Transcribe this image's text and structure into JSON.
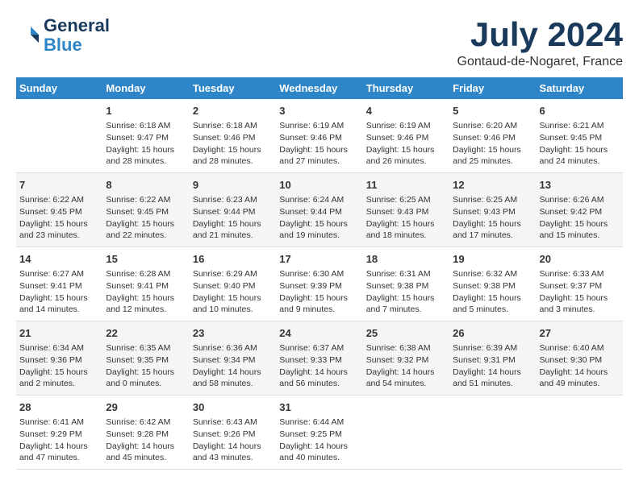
{
  "logo": {
    "general": "General",
    "blue": "Blue"
  },
  "title": "July 2024",
  "subtitle": "Gontaud-de-Nogaret, France",
  "days_header": [
    "Sunday",
    "Monday",
    "Tuesday",
    "Wednesday",
    "Thursday",
    "Friday",
    "Saturday"
  ],
  "weeks": [
    [
      {
        "num": "",
        "info": ""
      },
      {
        "num": "1",
        "info": "Sunrise: 6:18 AM\nSunset: 9:47 PM\nDaylight: 15 hours\nand 28 minutes."
      },
      {
        "num": "2",
        "info": "Sunrise: 6:18 AM\nSunset: 9:46 PM\nDaylight: 15 hours\nand 28 minutes."
      },
      {
        "num": "3",
        "info": "Sunrise: 6:19 AM\nSunset: 9:46 PM\nDaylight: 15 hours\nand 27 minutes."
      },
      {
        "num": "4",
        "info": "Sunrise: 6:19 AM\nSunset: 9:46 PM\nDaylight: 15 hours\nand 26 minutes."
      },
      {
        "num": "5",
        "info": "Sunrise: 6:20 AM\nSunset: 9:46 PM\nDaylight: 15 hours\nand 25 minutes."
      },
      {
        "num": "6",
        "info": "Sunrise: 6:21 AM\nSunset: 9:45 PM\nDaylight: 15 hours\nand 24 minutes."
      }
    ],
    [
      {
        "num": "7",
        "info": "Sunrise: 6:22 AM\nSunset: 9:45 PM\nDaylight: 15 hours\nand 23 minutes."
      },
      {
        "num": "8",
        "info": "Sunrise: 6:22 AM\nSunset: 9:45 PM\nDaylight: 15 hours\nand 22 minutes."
      },
      {
        "num": "9",
        "info": "Sunrise: 6:23 AM\nSunset: 9:44 PM\nDaylight: 15 hours\nand 21 minutes."
      },
      {
        "num": "10",
        "info": "Sunrise: 6:24 AM\nSunset: 9:44 PM\nDaylight: 15 hours\nand 19 minutes."
      },
      {
        "num": "11",
        "info": "Sunrise: 6:25 AM\nSunset: 9:43 PM\nDaylight: 15 hours\nand 18 minutes."
      },
      {
        "num": "12",
        "info": "Sunrise: 6:25 AM\nSunset: 9:43 PM\nDaylight: 15 hours\nand 17 minutes."
      },
      {
        "num": "13",
        "info": "Sunrise: 6:26 AM\nSunset: 9:42 PM\nDaylight: 15 hours\nand 15 minutes."
      }
    ],
    [
      {
        "num": "14",
        "info": "Sunrise: 6:27 AM\nSunset: 9:41 PM\nDaylight: 15 hours\nand 14 minutes."
      },
      {
        "num": "15",
        "info": "Sunrise: 6:28 AM\nSunset: 9:41 PM\nDaylight: 15 hours\nand 12 minutes."
      },
      {
        "num": "16",
        "info": "Sunrise: 6:29 AM\nSunset: 9:40 PM\nDaylight: 15 hours\nand 10 minutes."
      },
      {
        "num": "17",
        "info": "Sunrise: 6:30 AM\nSunset: 9:39 PM\nDaylight: 15 hours\nand 9 minutes."
      },
      {
        "num": "18",
        "info": "Sunrise: 6:31 AM\nSunset: 9:38 PM\nDaylight: 15 hours\nand 7 minutes."
      },
      {
        "num": "19",
        "info": "Sunrise: 6:32 AM\nSunset: 9:38 PM\nDaylight: 15 hours\nand 5 minutes."
      },
      {
        "num": "20",
        "info": "Sunrise: 6:33 AM\nSunset: 9:37 PM\nDaylight: 15 hours\nand 3 minutes."
      }
    ],
    [
      {
        "num": "21",
        "info": "Sunrise: 6:34 AM\nSunset: 9:36 PM\nDaylight: 15 hours\nand 2 minutes."
      },
      {
        "num": "22",
        "info": "Sunrise: 6:35 AM\nSunset: 9:35 PM\nDaylight: 15 hours\nand 0 minutes."
      },
      {
        "num": "23",
        "info": "Sunrise: 6:36 AM\nSunset: 9:34 PM\nDaylight: 14 hours\nand 58 minutes."
      },
      {
        "num": "24",
        "info": "Sunrise: 6:37 AM\nSunset: 9:33 PM\nDaylight: 14 hours\nand 56 minutes."
      },
      {
        "num": "25",
        "info": "Sunrise: 6:38 AM\nSunset: 9:32 PM\nDaylight: 14 hours\nand 54 minutes."
      },
      {
        "num": "26",
        "info": "Sunrise: 6:39 AM\nSunset: 9:31 PM\nDaylight: 14 hours\nand 51 minutes."
      },
      {
        "num": "27",
        "info": "Sunrise: 6:40 AM\nSunset: 9:30 PM\nDaylight: 14 hours\nand 49 minutes."
      }
    ],
    [
      {
        "num": "28",
        "info": "Sunrise: 6:41 AM\nSunset: 9:29 PM\nDaylight: 14 hours\nand 47 minutes."
      },
      {
        "num": "29",
        "info": "Sunrise: 6:42 AM\nSunset: 9:28 PM\nDaylight: 14 hours\nand 45 minutes."
      },
      {
        "num": "30",
        "info": "Sunrise: 6:43 AM\nSunset: 9:26 PM\nDaylight: 14 hours\nand 43 minutes."
      },
      {
        "num": "31",
        "info": "Sunrise: 6:44 AM\nSunset: 9:25 PM\nDaylight: 14 hours\nand 40 minutes."
      },
      {
        "num": "",
        "info": ""
      },
      {
        "num": "",
        "info": ""
      },
      {
        "num": "",
        "info": ""
      }
    ]
  ]
}
